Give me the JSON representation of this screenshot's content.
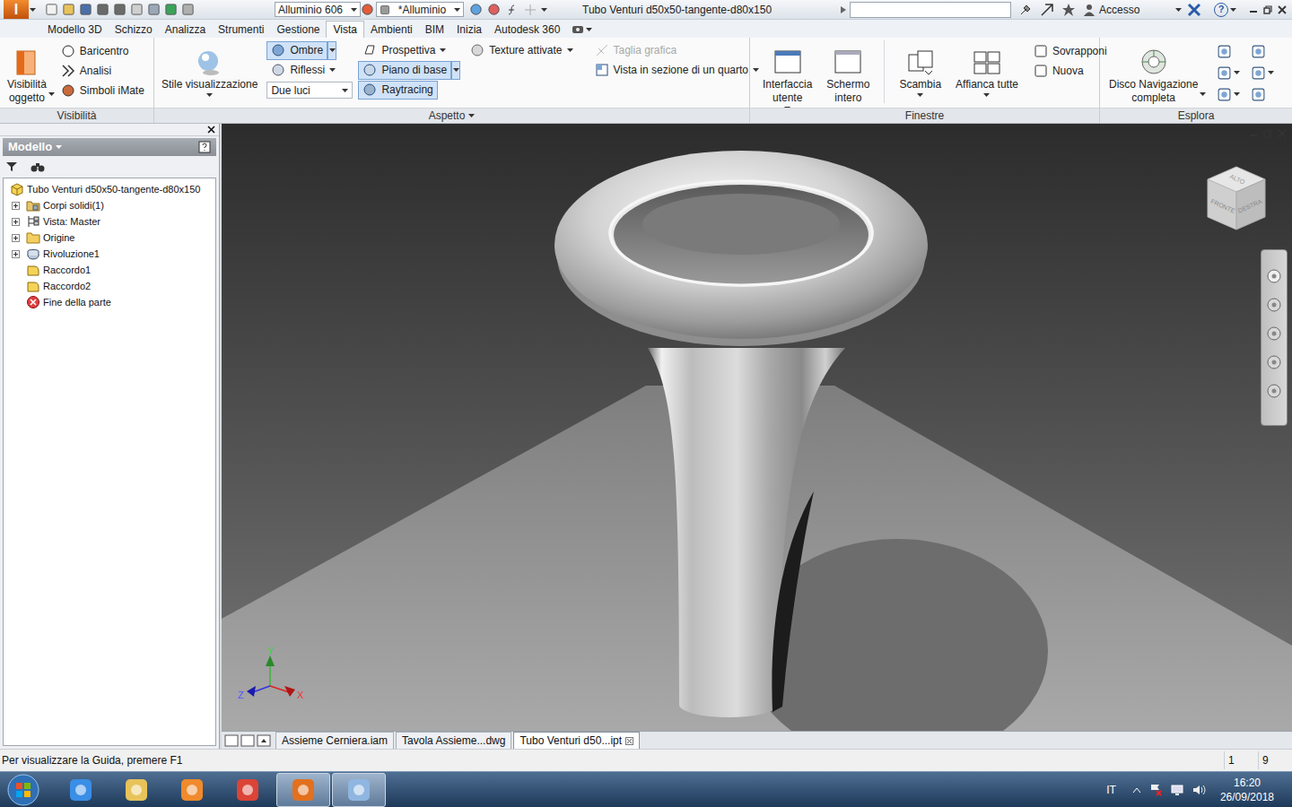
{
  "titlebar": {
    "app_letter": "I",
    "material": "Alluminio 606",
    "appearance": "*Alluminio",
    "title": "Tubo Venturi d50x50-tangente-d80x150",
    "login": "Accesso",
    "help": "?"
  },
  "ribbon_tabs": [
    {
      "label": "Modello 3D",
      "selected": false
    },
    {
      "label": "Schizzo",
      "selected": false
    },
    {
      "label": "Analizza",
      "selected": false
    },
    {
      "label": "Strumenti",
      "selected": false
    },
    {
      "label": "Gestione",
      "selected": false
    },
    {
      "label": "Vista",
      "selected": true
    },
    {
      "label": "Ambienti",
      "selected": false
    },
    {
      "label": "BIM",
      "selected": false
    },
    {
      "label": "Inizia",
      "selected": false
    },
    {
      "label": "Autodesk 360",
      "selected": false
    }
  ],
  "visibilita": {
    "title": "Visibilità",
    "large": [
      "Visibilità",
      "oggetto"
    ],
    "small": [
      "Baricentro",
      "Analisi",
      "Simboli iMate"
    ]
  },
  "aspetto": {
    "title": "Aspetto",
    "style": [
      "Stile visualizzazione"
    ],
    "ombre": {
      "label": "Ombre",
      "active": true
    },
    "riflessi": {
      "label": "Riflessi",
      "active": false
    },
    "luci": "Due luci",
    "prospettiva": {
      "label": "Prospettiva",
      "active": false
    },
    "piano": {
      "label": "Piano di base",
      "active": true
    },
    "raytracing": {
      "label": "Raytracing",
      "active": true
    },
    "texture": {
      "label": "Texture attivate",
      "active": false
    },
    "taglia": {
      "label": "Taglia grafica",
      "disabled": true
    },
    "sezione": {
      "label": "Vista in sezione di un quarto",
      "disabled": false
    }
  },
  "finestre": {
    "title": "Finestre",
    "large": [
      [
        "Interfaccia",
        "utente"
      ],
      [
        "Schermo",
        "intero"
      ],
      [
        "Scambia"
      ],
      [
        "Affianca tutte"
      ]
    ],
    "small": [
      "Sovrapponi",
      "Nuova"
    ]
  },
  "esplora": {
    "title": "Esplora",
    "large": [
      "Disco Navigazione",
      "completa"
    ]
  },
  "browser": {
    "title": "Modello",
    "items": [
      {
        "label": "Tubo Venturi d50x50-tangente-d80x150",
        "kind": "part",
        "level": 0,
        "expandable": false
      },
      {
        "label": "Corpi solidi(1)",
        "kind": "solids",
        "level": 1,
        "expandable": true
      },
      {
        "label": "Vista: Master",
        "kind": "view",
        "level": 1,
        "expandable": true
      },
      {
        "label": "Origine",
        "kind": "folder",
        "level": 1,
        "expandable": true
      },
      {
        "label": "Rivoluzione1",
        "kind": "revolve",
        "level": 1,
        "expandable": true
      },
      {
        "label": "Raccordo1",
        "kind": "fillet",
        "level": 1,
        "expandable": false
      },
      {
        "label": "Raccordo2",
        "kind": "fillet",
        "level": 1,
        "expandable": false
      },
      {
        "label": "Fine della parte",
        "kind": "end",
        "level": 1,
        "expandable": false
      }
    ]
  },
  "viewcube": {
    "top": "ALTO",
    "front": "FRONTE",
    "right": "DESTRA"
  },
  "axes": {
    "x": "X",
    "y": "Y",
    "z": "Z"
  },
  "doc_tabs": [
    {
      "label": "Assieme Cerniera.iam",
      "selected": false
    },
    {
      "label": "Tavola Assieme...dwg",
      "selected": false
    },
    {
      "label": "Tubo Venturi d50...ipt",
      "selected": true
    }
  ],
  "status_bar": {
    "text": "Per visualizzare la Guida, premere F1",
    "cells": [
      "1",
      "9"
    ]
  },
  "taskbar": {
    "lang": "IT",
    "time": "16:20",
    "date": "26/09/2018"
  }
}
